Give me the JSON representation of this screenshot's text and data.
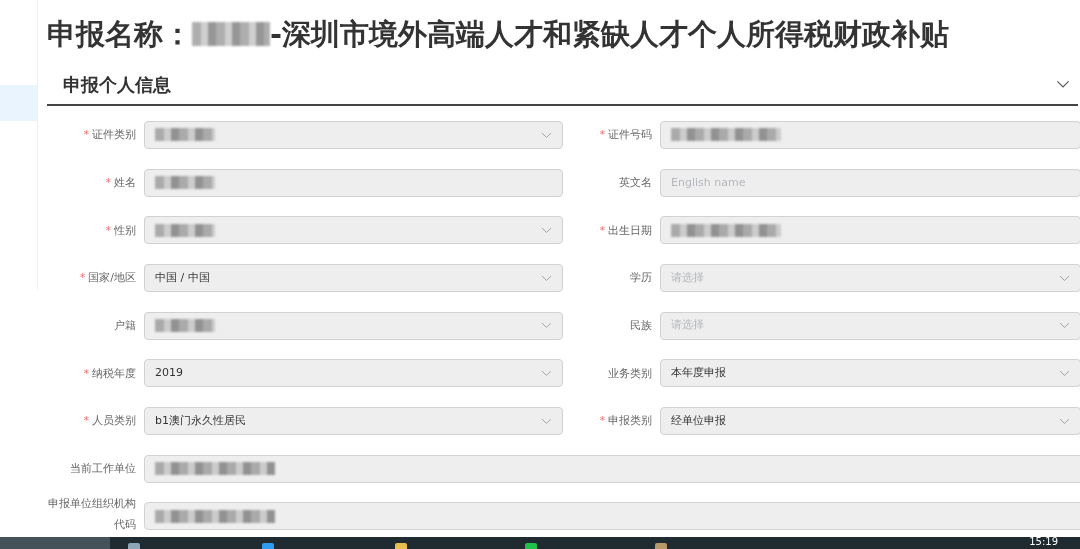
{
  "title": {
    "prefix": "申报名称：",
    "redacted": true,
    "suffix": "-深圳市境外高端人才和紧缺人才个人所得税财政补贴"
  },
  "section": {
    "heading": "申报个人信息",
    "expanded": true
  },
  "rows": [
    {
      "wide": false,
      "fields": [
        {
          "marker": "*",
          "label": "证件类别",
          "kind": "select",
          "redacted": true
        },
        {
          "marker": "*",
          "label": "证件号码",
          "kind": "input",
          "redacted": true
        }
      ]
    },
    {
      "wide": false,
      "fields": [
        {
          "marker": "*",
          "label": "姓名",
          "kind": "input",
          "redacted": true
        },
        {
          "label": "英文名",
          "kind": "input",
          "placeholder": "English name"
        }
      ]
    },
    {
      "wide": false,
      "fields": [
        {
          "marker": "*",
          "label": "性别",
          "kind": "select",
          "redacted": true
        },
        {
          "marker": "*",
          "label": "出生日期",
          "kind": "input",
          "redacted": true
        }
      ]
    },
    {
      "wide": false,
      "fields": [
        {
          "marker": "*",
          "label": "国家/地区",
          "kind": "select",
          "value": "中国 / 中国"
        },
        {
          "label": "学历",
          "kind": "select",
          "placeholder": "请选择"
        }
      ]
    },
    {
      "wide": false,
      "fields": [
        {
          "label": "户籍",
          "kind": "select",
          "redacted": true
        },
        {
          "label": "民族",
          "kind": "select",
          "placeholder": "请选择"
        }
      ]
    },
    {
      "wide": false,
      "fields": [
        {
          "marker": "*",
          "label": "纳税年度",
          "kind": "select",
          "value": "2019"
        },
        {
          "label": "业务类别",
          "kind": "select",
          "value": "本年度申报"
        }
      ]
    },
    {
      "wide": false,
      "fields": [
        {
          "marker": "*",
          "label": "人员类别",
          "kind": "select",
          "value": "b1澳门永久性居民"
        },
        {
          "marker": "*",
          "label": "申报类别",
          "kind": "select",
          "value": "经单位申报"
        }
      ]
    },
    {
      "wide": true,
      "fields": [
        {
          "label": "当前工作单位",
          "kind": "input",
          "redacted": true
        }
      ]
    },
    {
      "wide": true,
      "fields": [
        {
          "label": "申报单位组织机构代码",
          "kind": "input",
          "redacted": true
        }
      ]
    }
  ],
  "taskbar": {
    "time": "15:19"
  }
}
